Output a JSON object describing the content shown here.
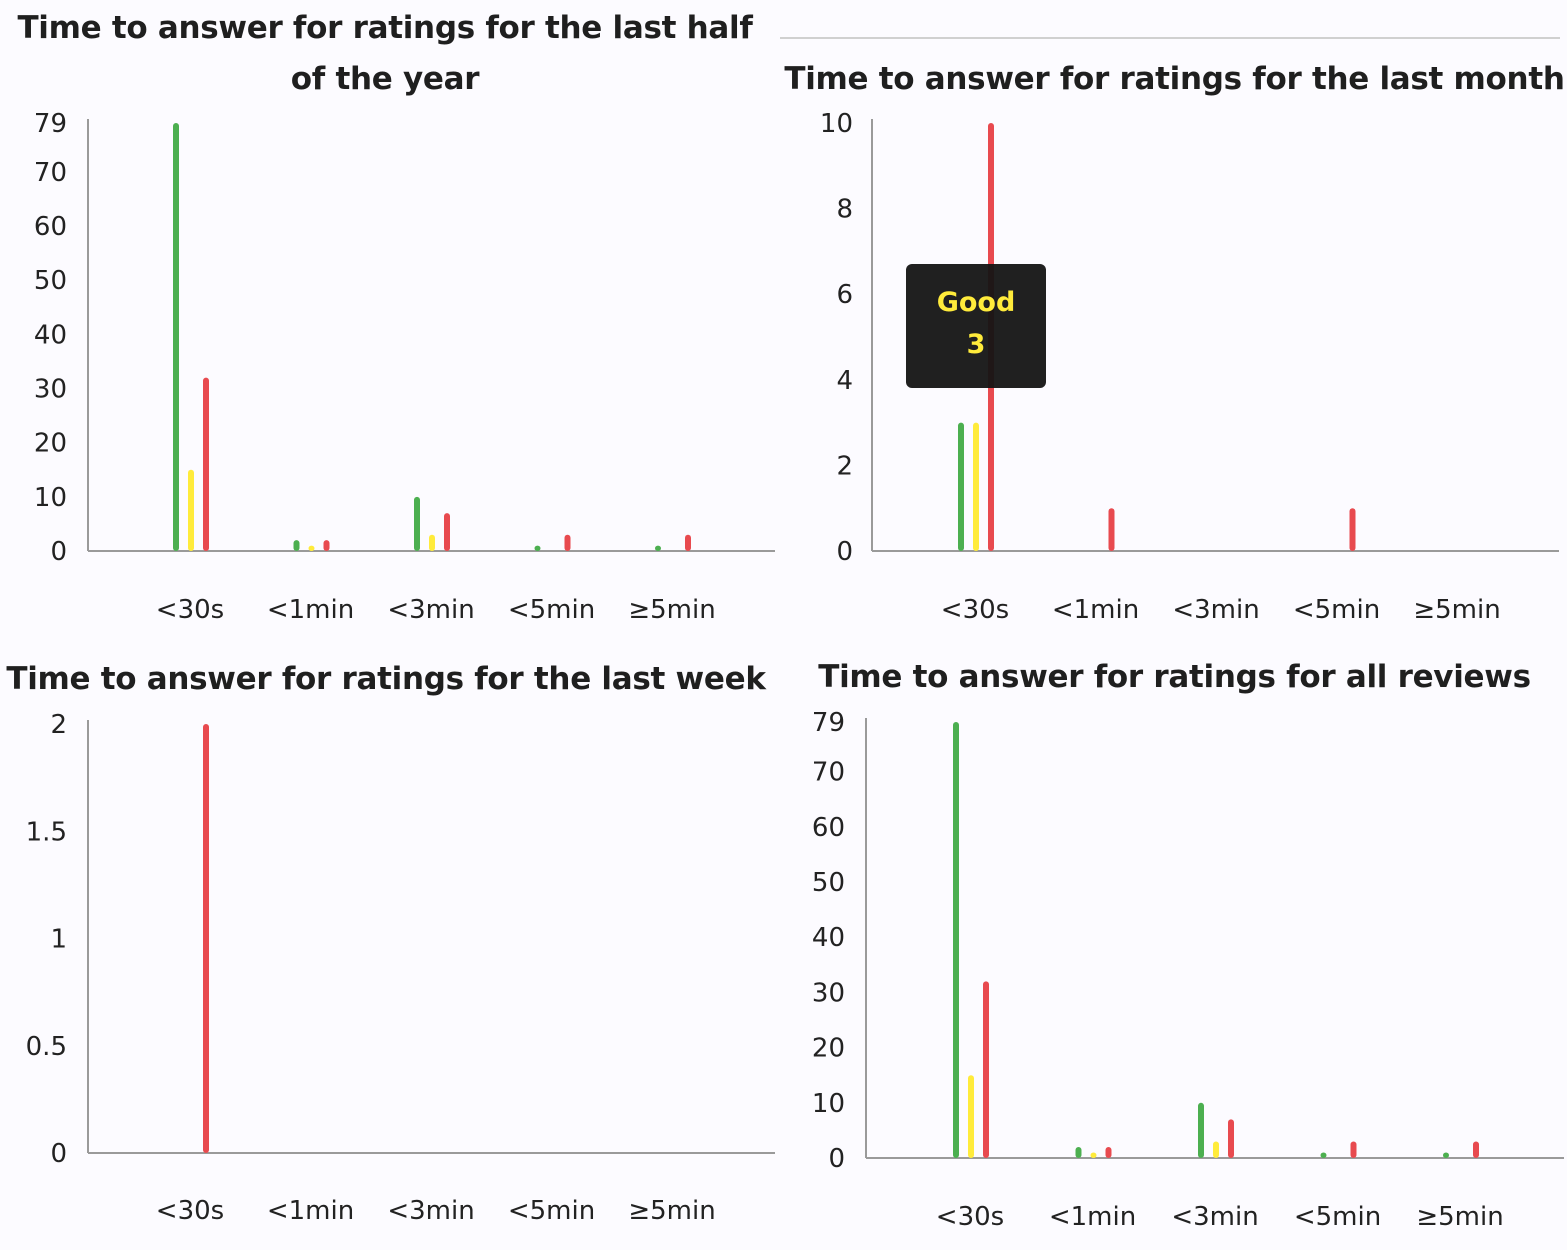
{
  "colors": {
    "good": "#4caf50",
    "neutral": "#ffeb3b",
    "bad": "#e84a4f"
  },
  "tooltip": {
    "label": "Good",
    "value": "3",
    "color": "#ffeb3b"
  },
  "chart_data": [
    {
      "type": "bar",
      "title": "Time to answer for ratings for the last half of the year",
      "categories": [
        "<30s",
        "<1min",
        "<3min",
        "<5min",
        "≥5min"
      ],
      "y_ticks": [
        "0",
        "10",
        "20",
        "30",
        "40",
        "50",
        "60",
        "70",
        "79"
      ],
      "ylim": [
        0,
        79
      ],
      "series": [
        {
          "key": "good",
          "values": [
            79,
            2,
            10,
            1,
            1
          ]
        },
        {
          "key": "neutral",
          "values": [
            15,
            1,
            3,
            0,
            0
          ]
        },
        {
          "key": "bad",
          "values": [
            32,
            2,
            7,
            3,
            3
          ]
        }
      ]
    },
    {
      "type": "bar",
      "title": "Time to answer for ratings for the last month",
      "categories": [
        "<30s",
        "<1min",
        "<3min",
        "<5min",
        "≥5min"
      ],
      "y_ticks": [
        "0",
        "2",
        "4",
        "6",
        "8",
        "10"
      ],
      "ylim": [
        0,
        10
      ],
      "series": [
        {
          "key": "good",
          "values": [
            3,
            0,
            0,
            0,
            0
          ]
        },
        {
          "key": "neutral",
          "values": [
            3,
            0,
            0,
            0,
            0
          ]
        },
        {
          "key": "bad",
          "values": [
            10,
            1,
            0,
            1,
            0
          ]
        }
      ]
    },
    {
      "type": "bar",
      "title": "Time to answer for ratings for the last week",
      "categories": [
        "<30s",
        "<1min",
        "<3min",
        "<5min",
        "≥5min"
      ],
      "y_ticks": [
        "0",
        "0.5",
        "1",
        "1.5",
        "2"
      ],
      "ylim": [
        0,
        2
      ],
      "series": [
        {
          "key": "good",
          "values": [
            0,
            0,
            0,
            0,
            0
          ]
        },
        {
          "key": "neutral",
          "values": [
            0,
            0,
            0,
            0,
            0
          ]
        },
        {
          "key": "bad",
          "values": [
            2,
            0,
            0,
            0,
            0
          ]
        }
      ]
    },
    {
      "type": "bar",
      "title": "Time to answer for ratings for all reviews",
      "categories": [
        "<30s",
        "<1min",
        "<3min",
        "<5min",
        "≥5min"
      ],
      "y_ticks": [
        "0",
        "10",
        "20",
        "30",
        "40",
        "50",
        "60",
        "70",
        "79"
      ],
      "ylim": [
        0,
        79
      ],
      "series": [
        {
          "key": "good",
          "values": [
            79,
            2,
            10,
            1,
            1
          ]
        },
        {
          "key": "neutral",
          "values": [
            15,
            1,
            3,
            0,
            0
          ]
        },
        {
          "key": "bad",
          "values": [
            32,
            2,
            7,
            3,
            3
          ]
        }
      ]
    }
  ]
}
